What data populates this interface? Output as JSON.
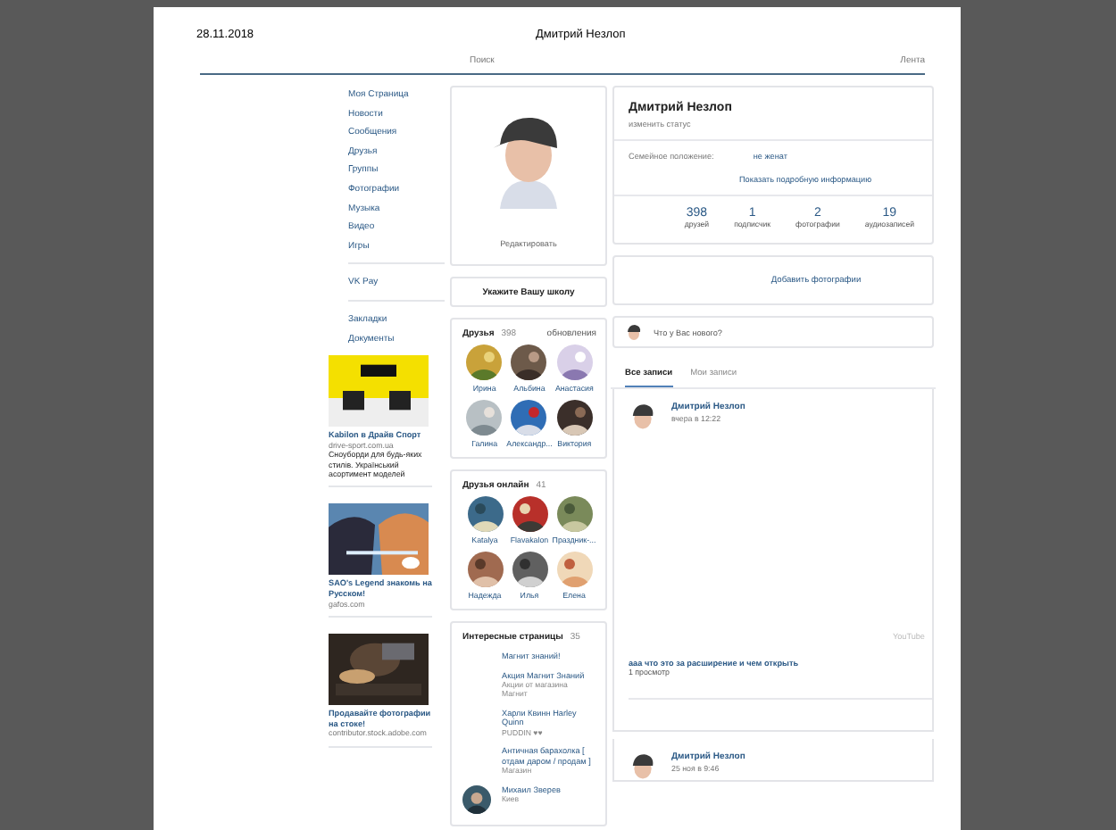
{
  "header": {
    "date": "28.11.2018",
    "title": "Дмитрий Незлоп",
    "links": [
      "Поиск",
      "Лента"
    ]
  },
  "menu": [
    [
      "Моя Страница",
      "Новости",
      "Сообщения",
      "Друзья",
      "Группы",
      "Фотографии",
      "Музыка",
      "Видео",
      "Игры"
    ],
    [
      "VK Pay"
    ],
    [
      "Закладки",
      "Документы"
    ]
  ],
  "ads": [
    {
      "title": "Kabilon в Драйв Спорт",
      "site": "drive-sport.com.ua",
      "text": "Сноуборди для будь-яких стилів. Український асортимент моделей"
    },
    {
      "title": "SAO's Legend знакомь на Русском!",
      "site": "gafos.com"
    },
    {
      "title": "Продавайте фотографии на стоке!",
      "site": "contributor.stock.adobe.com"
    }
  ],
  "profile_photo": {
    "edit": "Редактировать"
  },
  "school": "Укажите Вашу школу",
  "friends": {
    "title": "Друзья",
    "count": "398",
    "link": "обновления",
    "names": [
      "Ирина",
      "Альбина",
      "Анастасия",
      "Галина",
      "Александр...",
      "Виктория"
    ]
  },
  "friends_online": {
    "title": "Друзья онлайн",
    "count": "41",
    "names": [
      "Katalya",
      "Flavakalon",
      "Праздник-...",
      "Надежда",
      "Илья",
      "Елена"
    ]
  },
  "pages": {
    "title": "Интересные страницы",
    "count": "35",
    "items": [
      {
        "name": "Магнит знаний!",
        "avatar": false
      },
      {
        "name": "Акция Магнит Знаний",
        "sub": [
          "Акции от магазина",
          "Магнит"
        ],
        "avatar": false
      },
      {
        "name": "Харли Квинн Harley Quinn",
        "sub": [
          "PUDDIN ♥♥"
        ],
        "avatar": false
      },
      {
        "name": "Античная барахолка [ отдам даром / продам ]",
        "sub": [
          "Магазин"
        ],
        "avatar": false
      },
      {
        "name": "Михаил Зверев",
        "sub": [
          "Киев"
        ],
        "avatar": true
      }
    ]
  },
  "info": {
    "name": "Дмитрий Незлоп",
    "status": "изменить статус",
    "label": "Семейное положение:",
    "value": "не женат",
    "more": "Показать подробную информацию"
  },
  "counters": [
    {
      "value": "398",
      "label": "друзей"
    },
    {
      "value": "1",
      "label": "подписчик"
    },
    {
      "value": "2",
      "label": "фотографии"
    },
    {
      "value": "19",
      "label": "аудиозаписей"
    }
  ],
  "add_photos": "Добавить фотографии",
  "whats_new": "Что у Вас нового?",
  "tabs": [
    {
      "label": "Все записи",
      "selected": true
    },
    {
      "label": "Мои записи",
      "selected": false
    }
  ],
  "posts": [
    {
      "author": "Дмитрий Незлоп",
      "time": "вчера в 12:22",
      "video_label": "YouTube",
      "text": "ааа что это за расширение и чем открыть",
      "views": "1 просмотр"
    },
    {
      "author": "Дмитрий Незлоп",
      "time": "25 ноя в 9:46"
    }
  ]
}
